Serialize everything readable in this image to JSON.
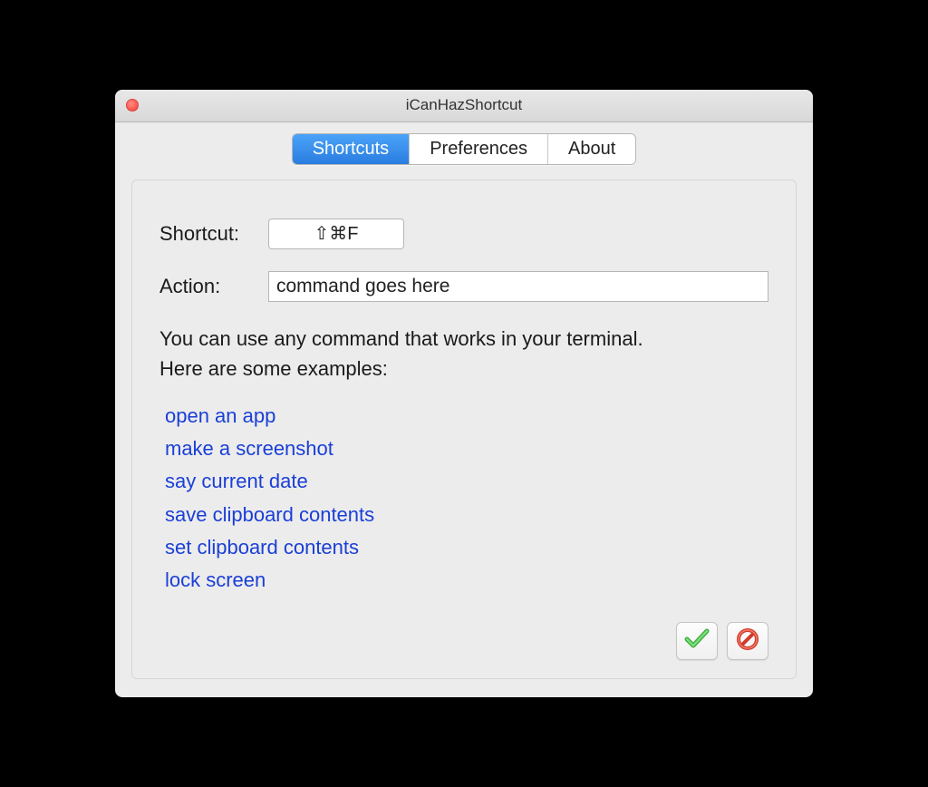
{
  "window": {
    "title": "iCanHazShortcut"
  },
  "tabs": {
    "shortcuts": "Shortcuts",
    "preferences": "Preferences",
    "about": "About"
  },
  "form": {
    "shortcut_label": "Shortcut:",
    "shortcut_value": "⇧⌘F",
    "action_label": "Action:",
    "action_value": "command goes here"
  },
  "help": {
    "line1": "You can use any command that works in your terminal.",
    "line2": "Here are some examples:"
  },
  "examples": [
    "open an app",
    "make a screenshot",
    "say current date",
    "save clipboard contents",
    "set clipboard contents",
    "lock screen"
  ]
}
